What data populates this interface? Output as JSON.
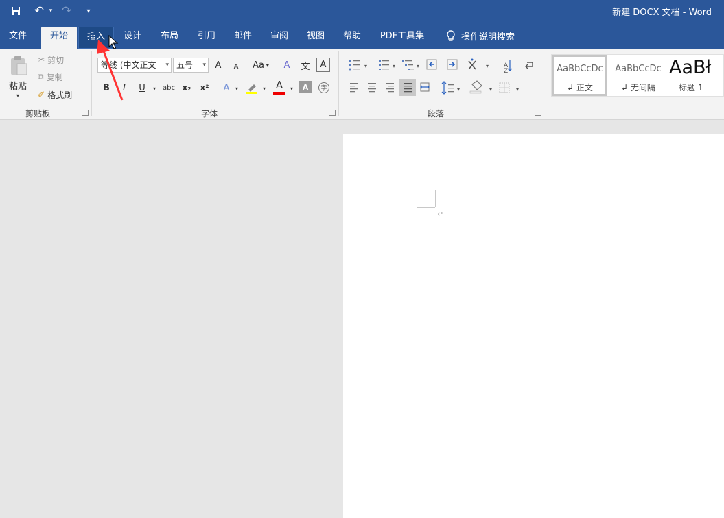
{
  "window": {
    "title": "新建 DOCX 文档 - Word"
  },
  "qat": {
    "undo_label": "↶",
    "redo_label": "↷",
    "more_label": "▾"
  },
  "tabs": [
    "文件",
    "开始",
    "插入",
    "设计",
    "布局",
    "引用",
    "邮件",
    "审阅",
    "视图",
    "帮助",
    "PDF工具集"
  ],
  "tell_me": "操作说明搜索",
  "clipboard": {
    "paste": "粘贴",
    "cut": "剪切",
    "copy": "复制",
    "format_painter": "格式刷",
    "group": "剪贴板"
  },
  "font": {
    "name": "等线 (中文正文",
    "size": "五号",
    "group": "字体",
    "grow": "A",
    "shrink": "A",
    "case": "Aa",
    "bold": "B",
    "italic": "I",
    "underline": "U",
    "strike": "abc",
    "sub": "x₂",
    "sup": "x²",
    "color_a": "A",
    "phonetic": "文",
    "border_a": "A"
  },
  "paragraph": {
    "group": "段落"
  },
  "styles": [
    {
      "sample": "AaBbCcDc",
      "name": "↲ 正文"
    },
    {
      "sample": "AaBbCcDc",
      "name": "↲ 无间隔"
    },
    {
      "sample": "AaBł",
      "name": "标题 1"
    }
  ],
  "document": {
    "para_mark": "↵"
  },
  "colors": {
    "accent": "#2b579a",
    "highlight": "#ffff00",
    "font_color": "#ff0000",
    "annotation": "#ff3333"
  }
}
